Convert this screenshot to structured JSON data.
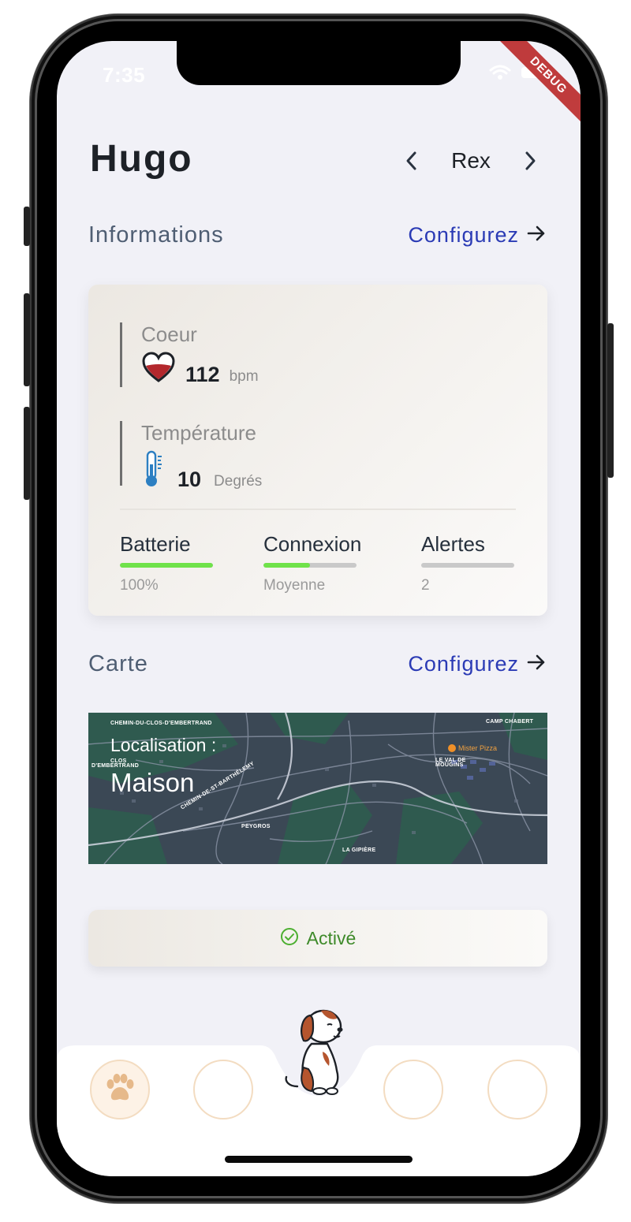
{
  "status_bar": {
    "time": "7:35",
    "debug_label": "DEBUG"
  },
  "header": {
    "title": "Hugo",
    "pet_name": "Rex"
  },
  "informations": {
    "section_title": "Informations",
    "configure_label": "Configurez",
    "heart": {
      "label": "Coeur",
      "value": "112",
      "unit": "bpm"
    },
    "temperature": {
      "label": "Température",
      "value": "10",
      "unit": "Degrés"
    },
    "stats": [
      {
        "label": "Batterie",
        "value": "100%",
        "level": 1.0
      },
      {
        "label": "Connexion",
        "value": "Moyenne",
        "level": 0.5
      },
      {
        "label": "Alertes",
        "value": "2",
        "level": 0.0
      }
    ]
  },
  "carte": {
    "section_title": "Carte",
    "configure_label": "Configurez",
    "location_title": "Localisation :",
    "location_value": "Maison",
    "map_places": [
      "CHEMIN-DU-CLOS-D'EMBERTRAND",
      "CLOS",
      "D'EMBERTRAND",
      "CHEMIN-DE-ST-BARTHÉLEMY",
      "PEYGROS",
      "LA GIPIÈRE",
      "CAMP CHABERT",
      "LE VAL DE",
      "MOUGINS",
      "Mister Pizza"
    ]
  },
  "status_button": {
    "label": "Activé"
  },
  "colors": {
    "accent_blue": "#2b3bb5",
    "active_green": "#3e8a2a",
    "bar_green": "#6fe24a",
    "nav_border": "#f3dcc1",
    "paw_color": "#e6b98a"
  },
  "icons": [
    "heart-icon",
    "thermometer-icon",
    "chevron-left-icon",
    "chevron-right-icon",
    "arrow-right-icon",
    "check-circle-icon",
    "paw-icon",
    "dog-mascot-icon",
    "wifi-icon",
    "battery-icon"
  ]
}
